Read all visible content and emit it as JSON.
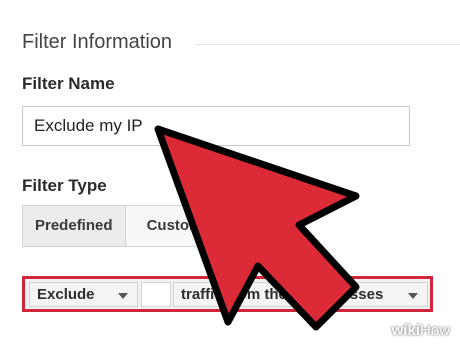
{
  "section": {
    "title": "Filter Information"
  },
  "filter_name": {
    "label": "Filter Name",
    "value": "Exclude my IP"
  },
  "filter_type": {
    "label": "Filter Type",
    "tabs": [
      {
        "label": "Predefined",
        "active": true
      },
      {
        "label": "Custom",
        "active": false
      }
    ]
  },
  "filter_row": {
    "action_select": "Exclude",
    "source_select": "traffic from the IP addresses",
    "highlight_color": "#d0253a"
  },
  "overlay": {
    "arrow_color": "#dc2a36",
    "arrow_outline": "#000000"
  },
  "watermark": {
    "wiki": "wiki",
    "how": "How"
  }
}
